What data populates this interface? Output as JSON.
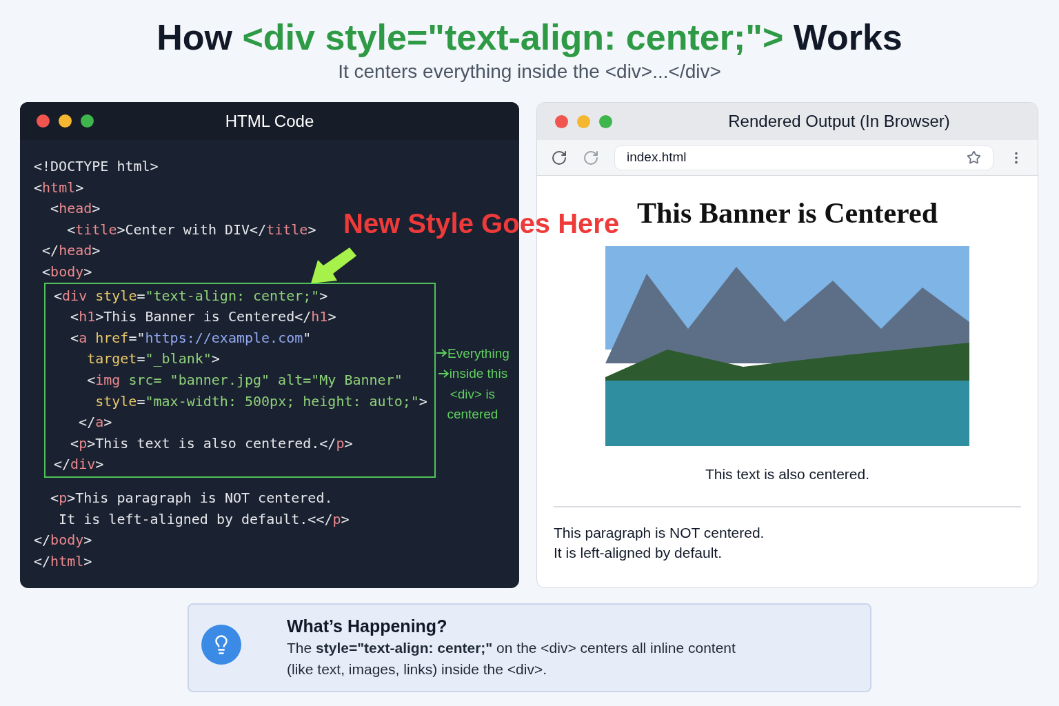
{
  "heading": {
    "parts": [
      {
        "kind": "plain",
        "text": "How "
      },
      {
        "kind": "accent",
        "text": "<div style=\"text-align: center;\">"
      },
      {
        "kind": "plain",
        "text": " Works"
      }
    ],
    "subtitle": "It centers everything inside the <div>...</div>"
  },
  "code_window": {
    "title": "HTML Code",
    "lines_before": [
      [
        {
          "kind": "punct",
          "text": "<!DOCTYPE html>"
        }
      ],
      [
        {
          "kind": "punct",
          "text": "<"
        },
        {
          "kind": "tag",
          "text": "html"
        },
        {
          "kind": "punct",
          "text": ">"
        }
      ],
      [
        {
          "kind": "punct",
          "text": "  <"
        },
        {
          "kind": "tag",
          "text": "head"
        },
        {
          "kind": "punct",
          "text": ">"
        }
      ],
      [
        {
          "kind": "punct",
          "text": "    <"
        },
        {
          "kind": "tag",
          "text": "title"
        },
        {
          "kind": "punct",
          "text": ">Center with DIV</"
        },
        {
          "kind": "tag",
          "text": "title"
        },
        {
          "kind": "punct",
          "text": ">"
        }
      ],
      [
        {
          "kind": "punct",
          "text": " </"
        },
        {
          "kind": "tag",
          "text": "head"
        },
        {
          "kind": "punct",
          "text": ">"
        }
      ],
      [
        {
          "kind": "punct",
          "text": " <"
        },
        {
          "kind": "tag",
          "text": "body"
        },
        {
          "kind": "punct",
          "text": ">"
        }
      ]
    ],
    "highlighted_lines": [
      [
        {
          "kind": "punct",
          "text": "<"
        },
        {
          "kind": "tag",
          "text": "div"
        },
        {
          "kind": "attr",
          "text": " style"
        },
        {
          "kind": "punct",
          "text": "="
        },
        {
          "kind": "string",
          "text": "\"text-align: center;\""
        },
        {
          "kind": "punct",
          "text": ">"
        }
      ],
      [
        {
          "kind": "punct",
          "text": "  <"
        },
        {
          "kind": "tag",
          "text": "h1"
        },
        {
          "kind": "punct",
          "text": ">This Banner is Centered</"
        },
        {
          "kind": "tag",
          "text": "h1"
        },
        {
          "kind": "punct",
          "text": ">"
        }
      ],
      [
        {
          "kind": "punct",
          "text": "  <"
        },
        {
          "kind": "tag",
          "text": "a"
        },
        {
          "kind": "attr",
          "text": " href"
        },
        {
          "kind": "punct",
          "text": "=\""
        },
        {
          "kind": "url",
          "text": "https://example.com"
        },
        {
          "kind": "punct",
          "text": "\""
        }
      ],
      [
        {
          "kind": "attr",
          "text": "    target"
        },
        {
          "kind": "punct",
          "text": "="
        },
        {
          "kind": "string",
          "text": "\"_blank\""
        },
        {
          "kind": "punct",
          "text": ">"
        }
      ],
      [
        {
          "kind": "punct",
          "text": "    <"
        },
        {
          "kind": "tag",
          "text": "img"
        },
        {
          "kind": "string",
          "text": " src= \"banner.jpg\" alt=\"My Banner\""
        }
      ],
      [
        {
          "kind": "attr",
          "text": "     style"
        },
        {
          "kind": "punct",
          "text": "="
        },
        {
          "kind": "string",
          "text": "\"max-width: 500px; height: auto;\""
        },
        {
          "kind": "punct",
          "text": ">"
        }
      ],
      [
        {
          "kind": "punct",
          "text": "   </"
        },
        {
          "kind": "tag",
          "text": "a"
        },
        {
          "kind": "punct",
          "text": ">"
        }
      ],
      [
        {
          "kind": "punct",
          "text": "  <"
        },
        {
          "kind": "tag",
          "text": "p"
        },
        {
          "kind": "punct",
          "text": ">This text is also centered.</"
        },
        {
          "kind": "tag",
          "text": "p"
        },
        {
          "kind": "punct",
          "text": ">"
        }
      ],
      [
        {
          "kind": "punct",
          "text": "</"
        },
        {
          "kind": "tag",
          "text": "div"
        },
        {
          "kind": "punct",
          "text": ">"
        }
      ]
    ],
    "lines_after": [
      [
        {
          "kind": "punct",
          "text": "  <"
        },
        {
          "kind": "tag",
          "text": "p"
        },
        {
          "kind": "punct",
          "text": ">This paragraph is NOT centered."
        }
      ],
      [
        {
          "kind": "punct",
          "text": "   It is left-aligned by default.<</"
        },
        {
          "kind": "tag",
          "text": "p"
        },
        {
          "kind": "punct",
          "text": ">"
        }
      ],
      [
        {
          "kind": "punct",
          "text": "</"
        },
        {
          "kind": "tag",
          "text": "body"
        },
        {
          "kind": "punct",
          "text": ">"
        }
      ],
      [
        {
          "kind": "punct",
          "text": "</"
        },
        {
          "kind": "tag",
          "text": "html"
        },
        {
          "kind": "punct",
          "text": ">"
        }
      ]
    ],
    "annotation": [
      "Everything",
      "inside this",
      "<div> is",
      "centered"
    ],
    "callout_label": "New Style Goes Here"
  },
  "browser_window": {
    "title": "Rendered Output (In Browser)",
    "address": "index.html",
    "page": {
      "heading": "This Banner is Centered",
      "caption": "This text is also centered.",
      "paragraph_lines": [
        "This paragraph is NOT centered.",
        "It is left-aligned by default."
      ]
    }
  },
  "info_box": {
    "title": "What’s Happening?",
    "lines": [
      "The **style=\"text-align: center;\"** on the <div> centers all inline content",
      "(like text, images, links) inside the <div>."
    ]
  }
}
